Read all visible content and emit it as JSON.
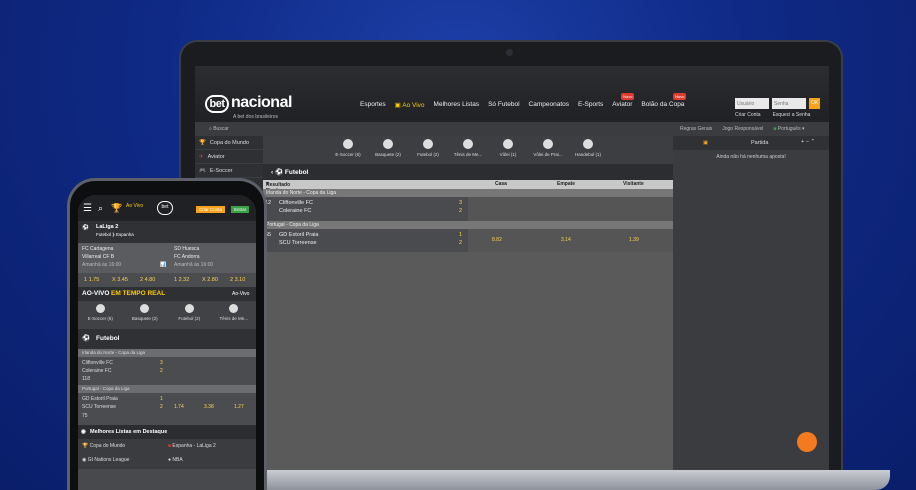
{
  "site": {
    "logo_text": "bet",
    "logo_suffix": "nacional",
    "tagline": "A bet dos brasileiros",
    "nav": [
      "Esportes",
      "Ao Vivo",
      "Melhores Listas",
      "Só Futebol",
      "Campeonatos",
      "E-Sports",
      "Aviator",
      "Bolão da Copa"
    ],
    "new_badge": "Novo",
    "user_placeholder": "Usuário",
    "pass_placeholder": "Senha",
    "ok": "OK",
    "create_account": "Criar Conta",
    "forgot": "Esqueci a Senha",
    "search": "Buscar",
    "rules": "Regras Gerais",
    "responsible": "Jogo Responsável",
    "language": "Português"
  },
  "sidebar": [
    "Copa do Mundo",
    "Aviator",
    "E-Soccer"
  ],
  "sports": [
    "E-Soccer (6)",
    "Basquete (2)",
    "Futebol (2)",
    "Tênis de Me...",
    "Vôlei (1)",
    "Vôlei de Prai...",
    "Handebol (1)"
  ],
  "futebol": {
    "title": "Futebol",
    "result_label": "Resultado Final",
    "col_casa": "Casa",
    "col_empate": "Empate",
    "col_visitante": "Visitante",
    "league1": "Irlanda do Norte - Copa da Liga",
    "m1_min": "12",
    "m1_home": "Cliftonville FC",
    "m1_away": "Coleraine FC",
    "m1_hs": "3",
    "m1_as": "2",
    "league2": "Portugal - Copa da Liga",
    "m2_min": "55",
    "m2_home": "GD Estoril Praia",
    "m2_away": "SCU Torreense",
    "m2_hs": "1",
    "m2_as": "2",
    "m2_casa": "8.82",
    "m2_empate": "3.14",
    "m2_visitante": "1.39"
  },
  "right_panel": {
    "tab": "Partida",
    "message": "Ainda não há nenhuma aposta!"
  },
  "phone": {
    "live": "Ao Vivo",
    "logo": "bet",
    "create": "Criar Conta",
    "enter": "Entrar",
    "league": "LaLiga 2",
    "league_sub": "Futebol ⟫ Espanha",
    "e1_home": "FC Cartagena",
    "e1_away": "Villarreal CF B",
    "e1_time": "Amanhã às 16:00",
    "e2_home": "SD Huesca",
    "e2_away": "FC Andorra",
    "e2_time": "Amanhã às 16:00",
    "odds": [
      "1 1.75",
      "X 3.45",
      "2 4.80",
      "1 2.32",
      "X 2.80",
      "2 3.10"
    ],
    "aovivo_a": "AO-VIVO",
    "aovivo_b": "EM TEMPO REAL",
    "aovivo_link": "Ao-Vivo",
    "sports": [
      "E-Soccer (6)",
      "Basquete (2)",
      "Futebol (2)",
      "Tênis de Me..."
    ],
    "fut_title": "Futebol",
    "l1": "Irlanda do Norte - Copa da Liga",
    "r1_home": "Cliftonville FC",
    "r1_away": "Coleraine FC",
    "r1_hs": "3",
    "r1_as": "2",
    "r1_min": "118",
    "l2": "Portugal - Copa da Liga",
    "r2_home": "GD Estoril Praia",
    "r2_away": "SCU Torreense",
    "r2_hs": "1",
    "r2_as": "2",
    "r2_min": "75",
    "r2_o1": "1.74",
    "r2_o2": "3.38",
    "r2_o3": "1.27",
    "lists_title": "Melhores Listas em Destaque",
    "list": [
      "Copa do Mundo",
      "Espanha - LaLiga 2",
      "Gt Nations League",
      "NBA"
    ]
  }
}
